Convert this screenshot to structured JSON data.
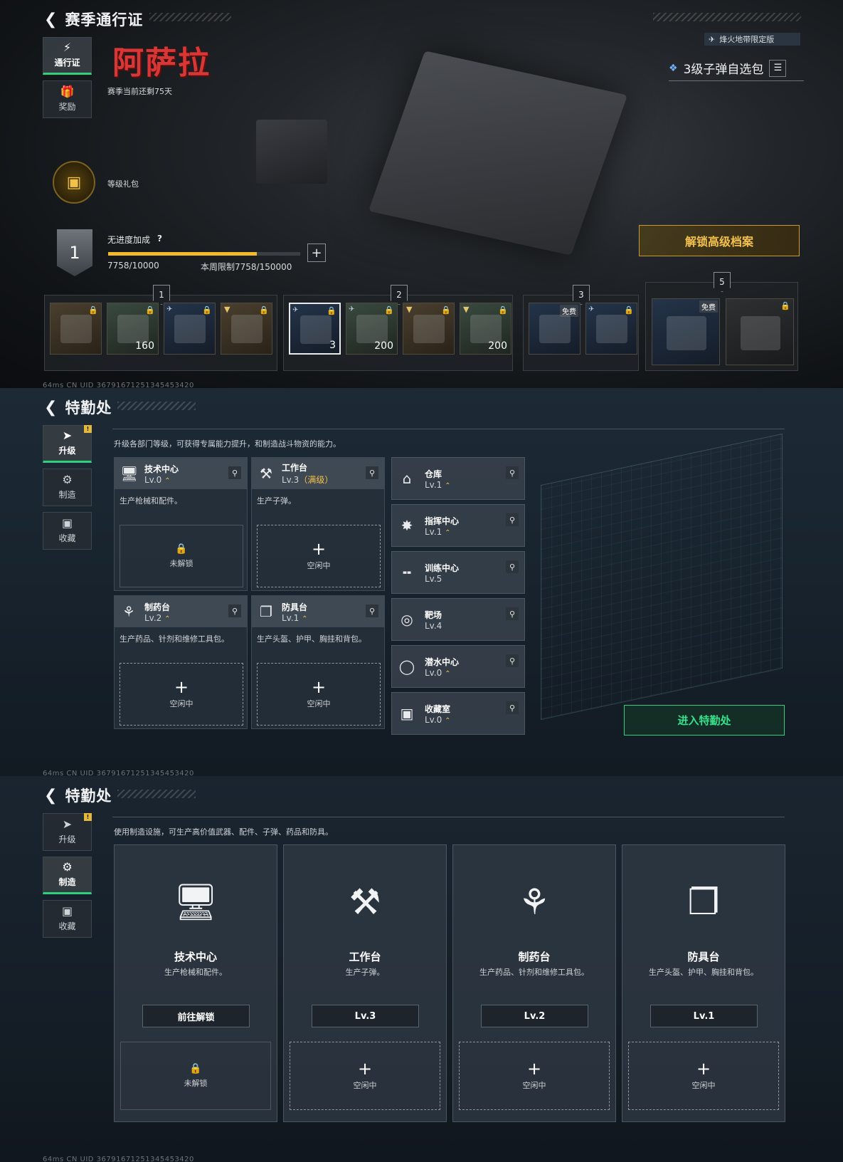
{
  "pass": {
    "title": "赛季通行证",
    "tabs": [
      {
        "label": "通行证",
        "icon": "pass-icon"
      },
      {
        "label": "奖励",
        "icon": "gift-icon"
      }
    ],
    "season_logo": "阿萨拉",
    "season_remaining": "赛季当前还剩75天",
    "level_gift": "等级礼包",
    "limited_badge": "烽火地带限定版",
    "selected_item": "3级子弹自选包",
    "rank": "1",
    "bonus_label": "无进度加成",
    "help_mark": "?",
    "progress_current": 7758,
    "progress_max": 10000,
    "progress_text": "7758/10000",
    "weekly_limit": "本周限制7758/150000",
    "unlock_btn": "解锁高级档案",
    "tiers": [
      {
        "label": "1",
        "items": [
          {
            "count": ""
          },
          {
            "count": "160"
          },
          {
            "count": ""
          },
          {
            "count": ""
          }
        ]
      },
      {
        "label": "2",
        "items": [
          {
            "count": "3"
          },
          {
            "count": "200"
          },
          {
            "count": ""
          },
          {
            "count": "200"
          }
        ]
      },
      {
        "label": "3",
        "items": [
          {
            "free": "免费"
          },
          {
            "free": ""
          }
        ]
      },
      {
        "label": "5",
        "items": [
          {
            "free": "免费"
          },
          {
            "free": ""
          }
        ]
      }
    ],
    "status": "64ms     CN UID 3679167125134545342​0"
  },
  "dept": {
    "title": "特勤处",
    "tabs": [
      {
        "label": "升级",
        "icon": "upgrade-icon"
      },
      {
        "label": "制造",
        "icon": "craft-icon"
      },
      {
        "label": "收藏",
        "icon": "collection-icon"
      }
    ],
    "badge": "!",
    "desc": "升级各部门等级，可获得专属能力提升，和制造战斗物资的能力。",
    "cards": [
      {
        "name": "技术中心",
        "level": "Lv.0",
        "maxed": "",
        "desc": "生产枪械和配件。",
        "slot": "未解锁"
      },
      {
        "name": "工作台",
        "level": "Lv.3",
        "maxed": "（满级）",
        "desc": "生产子弹。",
        "slot": "空闲中"
      },
      {
        "name": "制药台",
        "level": "Lv.2",
        "maxed": "",
        "desc": "生产药品、针剂和维修工具包。",
        "slot": "空闲中"
      },
      {
        "name": "防具台",
        "level": "Lv.1",
        "maxed": "",
        "desc": "生产头盔、护甲、胸挂和背包。",
        "slot": "空闲中"
      }
    ],
    "rooms": [
      {
        "name": "仓库",
        "level": "Lv.1"
      },
      {
        "name": "指挥中心",
        "level": "Lv.1"
      },
      {
        "name": "训练中心",
        "level": "Lv.5"
      },
      {
        "name": "靶场",
        "level": "Lv.4"
      },
      {
        "name": "潜水中心",
        "level": "Lv.0"
      },
      {
        "name": "收藏室",
        "level": "Lv.0"
      }
    ],
    "enter_btn": "进入特勤处",
    "status": "64ms     CN UID 36791671251345453420"
  },
  "craft": {
    "title": "特勤处",
    "desc": "使用制造设施，可生产高价值武器、配件、子弹、药品和防具。",
    "cards": [
      {
        "name": "技术中心",
        "desc": "生产枪械和配件。",
        "btn": "前往解锁",
        "slot": "未解锁"
      },
      {
        "name": "工作台",
        "desc": "生产子弹。",
        "btn": "Lv.3",
        "slot": "空闲中"
      },
      {
        "name": "制药台",
        "desc": "生产药品、针剂和维修工具包。",
        "btn": "Lv.2",
        "slot": "空闲中"
      },
      {
        "name": "防具台",
        "desc": "生产头盔、护甲、胸挂和背包。",
        "btn": "Lv.1",
        "slot": "空闲中"
      }
    ],
    "status": "64ms     CN UID 36791671251345453420"
  },
  "colors": {
    "accent_gold": "#f2b92c",
    "accent_green": "#2fd07c"
  }
}
